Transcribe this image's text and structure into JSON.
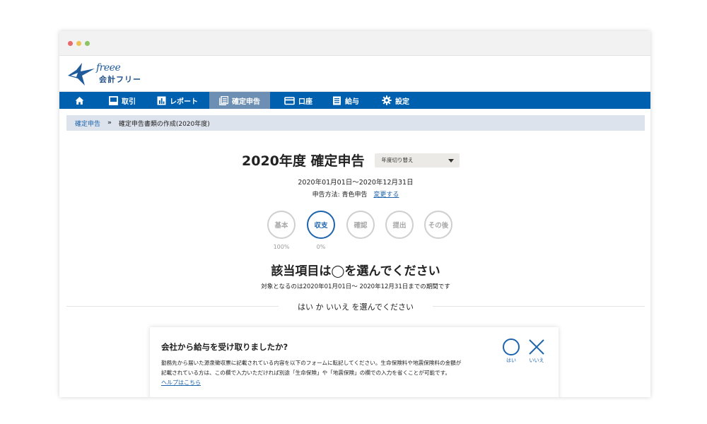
{
  "window": {
    "logo": {
      "script": "freee",
      "name": "会計フリー"
    }
  },
  "nav": {
    "items": [
      {
        "label": "",
        "icon": "home-icon"
      },
      {
        "label": "取引",
        "icon": "inbox-icon"
      },
      {
        "label": "レポート",
        "icon": "bar-chart-icon"
      },
      {
        "label": "確定申告",
        "icon": "document-icon"
      },
      {
        "label": "口座",
        "icon": "credit-card-icon"
      },
      {
        "label": "給与",
        "icon": "list-icon"
      },
      {
        "label": "設定",
        "icon": "gear-icon"
      }
    ],
    "active_index": 3,
    "bar_color": "#0060b0"
  },
  "breadcrumb": {
    "link": "確定申告",
    "separator": "»",
    "current": "確定申告書類の作成(2020年度)"
  },
  "header": {
    "title": "2020年度 確定申告",
    "year_select": "年度切り替え",
    "period": "2020年01月01日〜2020年12月31日",
    "method_label": "申告方法: 青色申告",
    "method_link": "変更する"
  },
  "steps": [
    {
      "label": "基本",
      "progress": "100%"
    },
    {
      "label": "収支",
      "progress": "0%",
      "active": true
    },
    {
      "label": "確認",
      "progress": ""
    },
    {
      "label": "提出",
      "progress": ""
    },
    {
      "label": "その後",
      "progress": ""
    }
  ],
  "question": {
    "title": "該当項目は◯を選んでください",
    "subtitle": "対象となるのは2020年01月01日〜 2020年12月31日までの期間です",
    "instruction": "はい か いいえ を選んでください"
  },
  "card": {
    "title": "会社から給与を受け取りましたか?",
    "description_line1": "勤務先から届いた源泉徴収票に記載されている内容を以下のフォームに転記してください。生命保険料や地震保険料の金額が",
    "description_line2": "記載されている方は、この欄で入力いただければ別途「生命保険」や「地震保険」の欄での入力を省くことが可能です。",
    "help_link": "ヘルプはこちら",
    "yes_label": "はい",
    "no_label": "いいえ"
  }
}
